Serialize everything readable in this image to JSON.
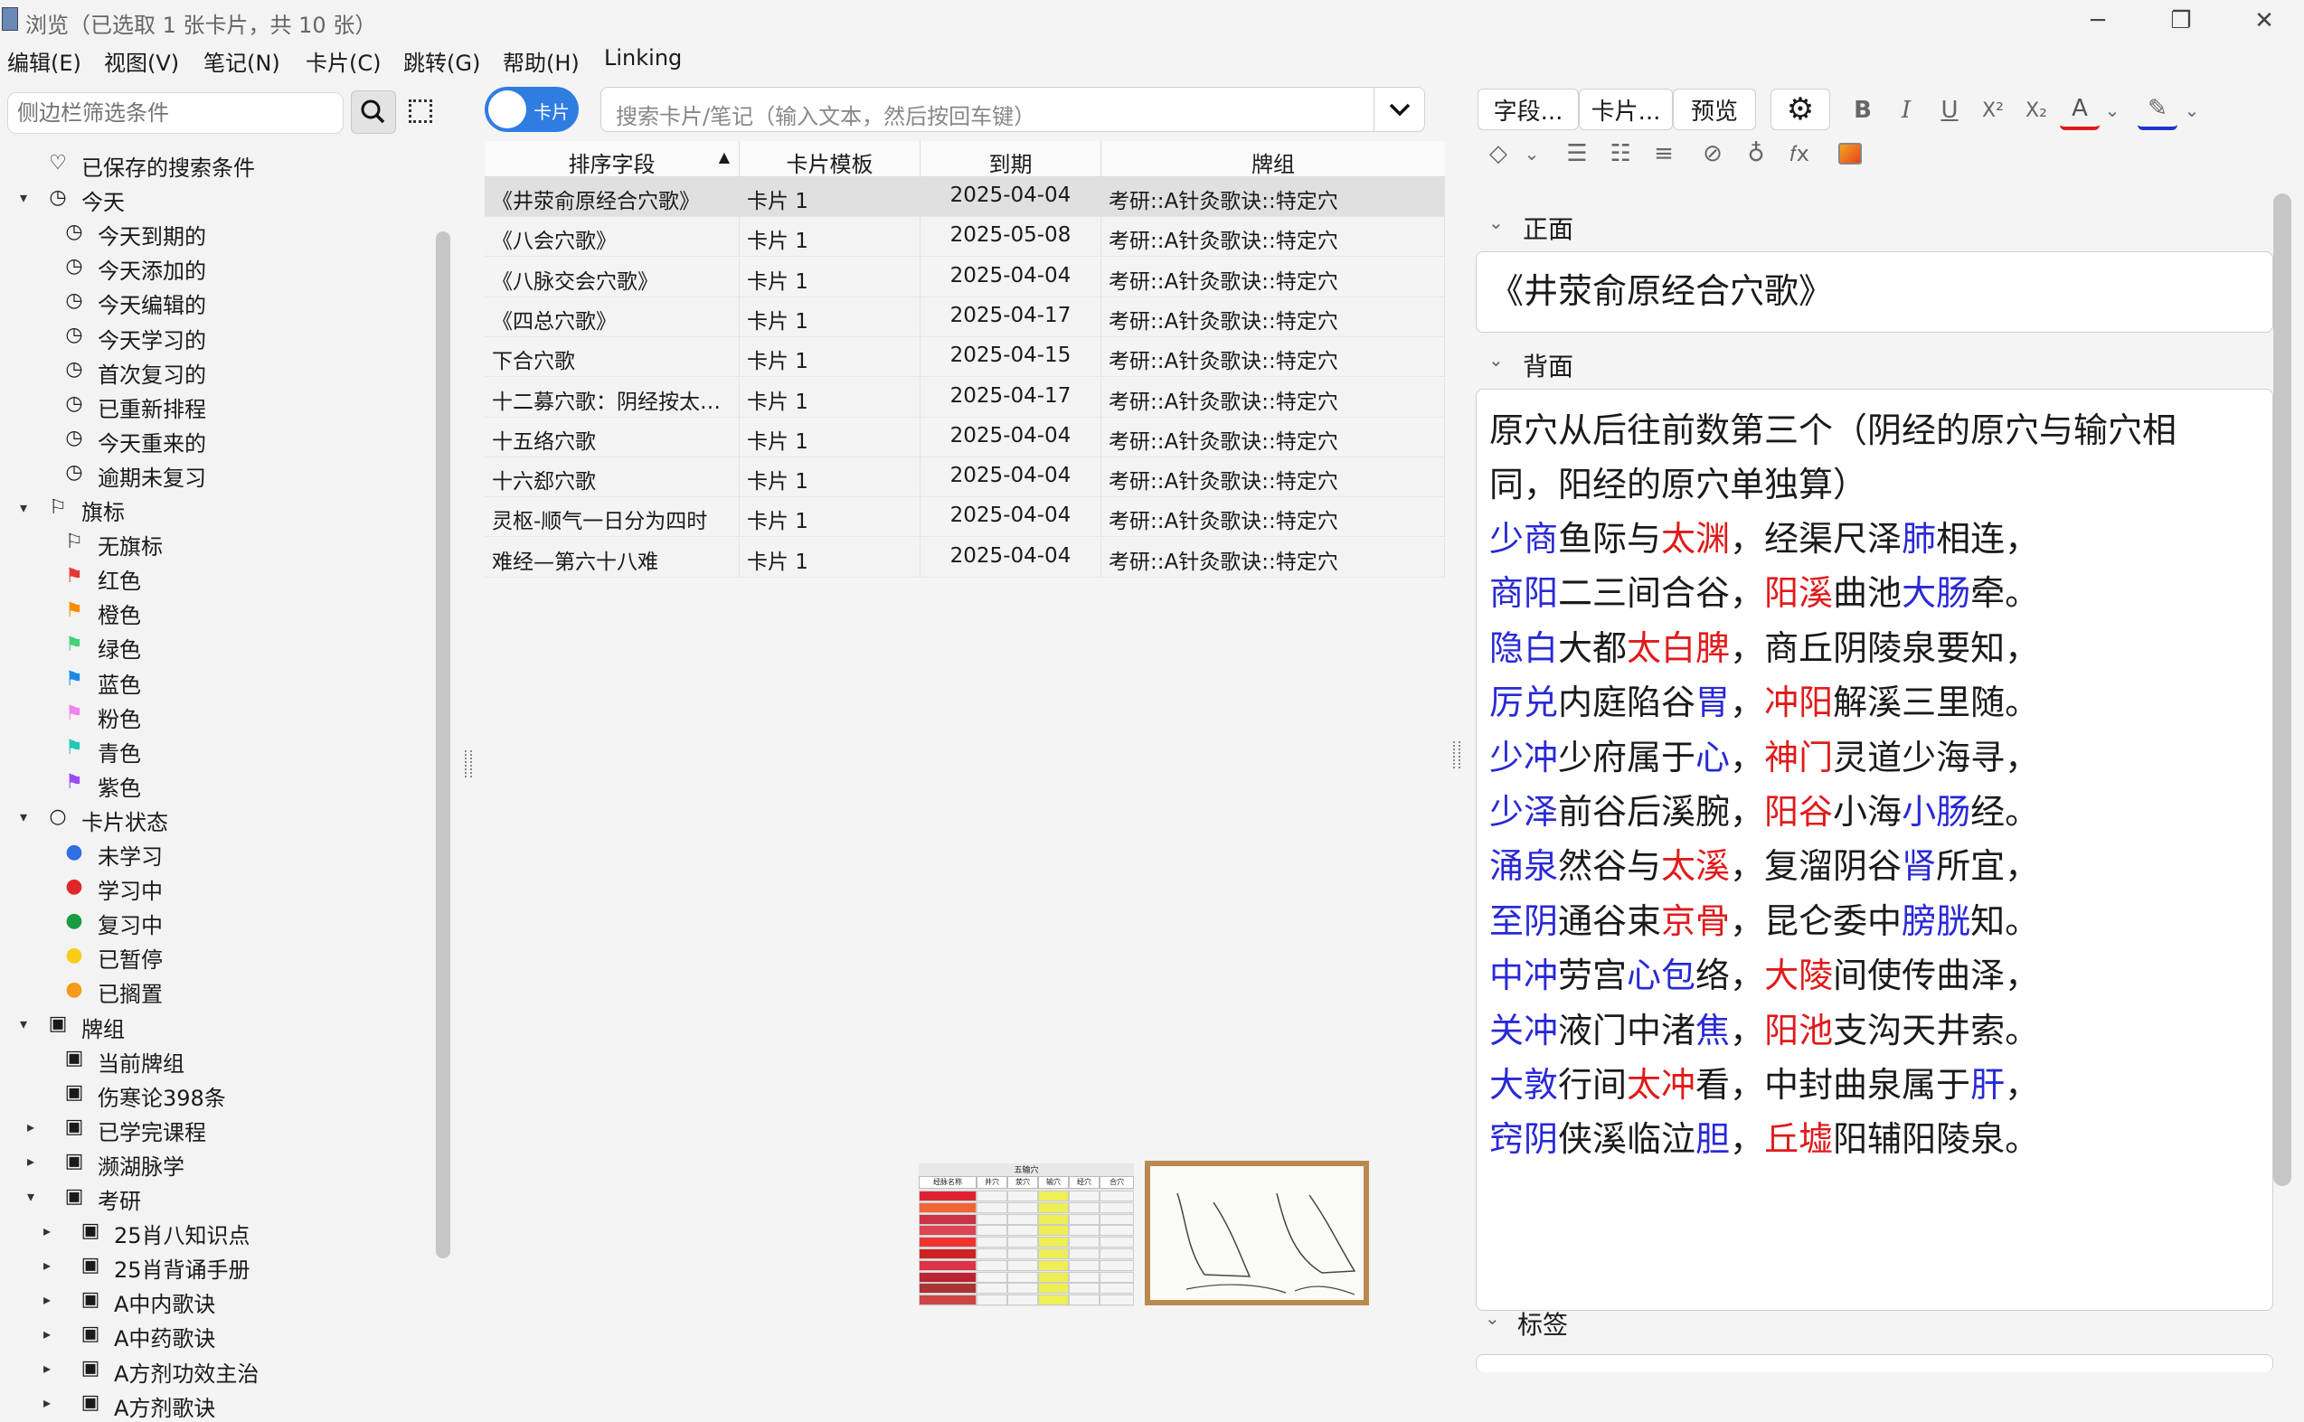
{
  "window": {
    "title": "浏览（已选取 1 张卡片，共 10 张）",
    "controls": [
      "─",
      "❐",
      "✕"
    ]
  },
  "menu": [
    "编辑(E)",
    "视图(V)",
    "笔记(N)",
    "卡片(C)",
    "跳转(G)",
    "帮助(H)",
    "Linking"
  ],
  "sidebar": {
    "filter_placeholder": "侧边栏筛选条件",
    "tree": [
      {
        "label": "已保存的搜索条件",
        "icon": "heart-icon",
        "glyph": "♡",
        "depth": 0,
        "arrow": ""
      },
      {
        "label": "今天",
        "icon": "clock-icon",
        "glyph": "◷",
        "depth": 0,
        "arrow": "▾"
      },
      {
        "label": "今天到期的",
        "icon": "clock-icon",
        "glyph": "◷",
        "depth": 1,
        "arrow": ""
      },
      {
        "label": "今天添加的",
        "icon": "clock-icon",
        "glyph": "◷",
        "depth": 1,
        "arrow": ""
      },
      {
        "label": "今天编辑的",
        "icon": "clock-icon",
        "glyph": "◷",
        "depth": 1,
        "arrow": ""
      },
      {
        "label": "今天学习的",
        "icon": "clock-icon",
        "glyph": "◷",
        "depth": 1,
        "arrow": ""
      },
      {
        "label": "首次复习的",
        "icon": "clock-icon",
        "glyph": "◷",
        "depth": 1,
        "arrow": ""
      },
      {
        "label": "已重新排程",
        "icon": "clock-icon",
        "glyph": "◷",
        "depth": 1,
        "arrow": ""
      },
      {
        "label": "今天重来的",
        "icon": "clock-icon",
        "glyph": "◷",
        "depth": 1,
        "arrow": ""
      },
      {
        "label": "逾期未复习",
        "icon": "clock-icon",
        "glyph": "◷",
        "depth": 1,
        "arrow": ""
      },
      {
        "label": "旗标",
        "icon": "flag-outline-icon",
        "glyph": "⚐",
        "depth": 0,
        "arrow": "▾"
      },
      {
        "label": "无旗标",
        "icon": "no-flag-icon",
        "glyph": "⚐",
        "depth": 1,
        "arrow": "",
        "color": "#222222"
      },
      {
        "label": "红色",
        "icon": "flag-red-icon",
        "glyph": "⚑",
        "depth": 1,
        "arrow": "",
        "color": "#e53935"
      },
      {
        "label": "橙色",
        "icon": "flag-orange-icon",
        "glyph": "⚑",
        "depth": 1,
        "arrow": "",
        "color": "#fb8c00"
      },
      {
        "label": "绿色",
        "icon": "flag-green-icon",
        "glyph": "⚑",
        "depth": 1,
        "arrow": "",
        "color": "#43d17a"
      },
      {
        "label": "蓝色",
        "icon": "flag-blue-icon",
        "glyph": "⚑",
        "depth": 1,
        "arrow": "",
        "color": "#1e88e5"
      },
      {
        "label": "粉色",
        "icon": "flag-pink-icon",
        "glyph": "⚑",
        "depth": 1,
        "arrow": "",
        "color": "#ee82ee"
      },
      {
        "label": "青色",
        "icon": "flag-cyan-icon",
        "glyph": "⚑",
        "depth": 1,
        "arrow": "",
        "color": "#26c6b5"
      },
      {
        "label": "紫色",
        "icon": "flag-purple-icon",
        "glyph": "⚑",
        "depth": 1,
        "arrow": "",
        "color": "#9a4cf0"
      },
      {
        "label": "卡片状态",
        "icon": "circle-outline-icon",
        "glyph": "○",
        "depth": 0,
        "arrow": "▾"
      },
      {
        "label": "未学习",
        "icon": "dot-blue-icon",
        "glyph": "●",
        "depth": 1,
        "arrow": "",
        "color": "#2f6fe0"
      },
      {
        "label": "学习中",
        "icon": "dot-red-icon",
        "glyph": "●",
        "depth": 1,
        "arrow": "",
        "color": "#e0262b"
      },
      {
        "label": "复习中",
        "icon": "dot-green-icon",
        "glyph": "●",
        "depth": 1,
        "arrow": "",
        "color": "#1a9b3f"
      },
      {
        "label": "已暂停",
        "icon": "dot-yellow-icon",
        "glyph": "●",
        "depth": 1,
        "arrow": "",
        "color": "#f7cd1a"
      },
      {
        "label": "已搁置",
        "icon": "dot-orange-icon",
        "glyph": "●",
        "depth": 1,
        "arrow": "",
        "color": "#f59a1a"
      },
      {
        "label": "牌组",
        "icon": "deck-icon",
        "glyph": "▣",
        "depth": 0,
        "arrow": "▾"
      },
      {
        "label": "当前牌组",
        "icon": "current-deck-icon",
        "glyph": "▣",
        "depth": 1,
        "arrow": ""
      },
      {
        "label": "伤寒论398条",
        "icon": "deck-icon",
        "glyph": "▣",
        "depth": 1,
        "arrow": ""
      },
      {
        "label": "已学完课程",
        "icon": "deck-icon",
        "glyph": "▣",
        "depth": 1,
        "arrow": "▸"
      },
      {
        "label": "濒湖脉学",
        "icon": "deck-icon",
        "glyph": "▣",
        "depth": 1,
        "arrow": "▸"
      },
      {
        "label": "考研",
        "icon": "deck-icon",
        "glyph": "▣",
        "depth": 1,
        "arrow": "▾"
      },
      {
        "label": "25肖八知识点",
        "icon": "deck-icon",
        "glyph": "▣",
        "depth": 2,
        "arrow": "▸"
      },
      {
        "label": "25肖背诵手册",
        "icon": "deck-icon",
        "glyph": "▣",
        "depth": 2,
        "arrow": "▸"
      },
      {
        "label": "A中内歌诀",
        "icon": "deck-icon",
        "glyph": "▣",
        "depth": 2,
        "arrow": "▸"
      },
      {
        "label": "A中药歌诀",
        "icon": "deck-icon",
        "glyph": "▣",
        "depth": 2,
        "arrow": "▸"
      },
      {
        "label": "A方剂功效主治",
        "icon": "deck-icon",
        "glyph": "▣",
        "depth": 2,
        "arrow": "▸"
      },
      {
        "label": "A方剂歌诀",
        "icon": "deck-icon",
        "glyph": "▣",
        "depth": 2,
        "arrow": "▸"
      }
    ]
  },
  "browser": {
    "toggle_label": "卡片",
    "search_placeholder": "搜索卡片/笔记（输入文本，然后按回车键）",
    "columns": [
      "排序字段",
      "卡片模板",
      "到期",
      "牌组"
    ],
    "sort_arrow": "▲",
    "rows": [
      [
        "《井荥俞原经合穴歌》",
        "卡片 1",
        "2025-04-04",
        "考研::A针灸歌诀::特定穴"
      ],
      [
        "《八会穴歌》",
        "卡片 1",
        "2025-05-08",
        "考研::A针灸歌诀::特定穴"
      ],
      [
        "《八脉交会穴歌》",
        "卡片 1",
        "2025-04-04",
        "考研::A针灸歌诀::特定穴"
      ],
      [
        "《四总穴歌》",
        "卡片 1",
        "2025-04-17",
        "考研::A针灸歌诀::特定穴"
      ],
      [
        "下合穴歌",
        "卡片 1",
        "2025-04-15",
        "考研::A针灸歌诀::特定穴"
      ],
      [
        "十二募穴歌：阴经按太…",
        "卡片 1",
        "2025-04-17",
        "考研::A针灸歌诀::特定穴"
      ],
      [
        "十五络穴歌",
        "卡片 1",
        "2025-04-04",
        "考研::A针灸歌诀::特定穴"
      ],
      [
        "十六郄穴歌",
        "卡片 1",
        "2025-04-04",
        "考研::A针灸歌诀::特定穴"
      ],
      [
        "灵枢-顺气一日分为四时",
        "卡片 1",
        "2025-04-04",
        "考研::A针灸歌诀::特定穴"
      ],
      [
        "难经—第六十八难",
        "卡片 1",
        "2025-04-04",
        "考研::A针灸歌诀::特定穴"
      ]
    ]
  },
  "editor": {
    "fields_button": "字段...",
    "cards_button": "卡片...",
    "preview_button": "预览",
    "format": {
      "bold": "B",
      "italic": "I",
      "underline": "U",
      "sup": "X²",
      "sub": "X₂",
      "color_a": "A",
      "dd": "⌄",
      "fx": "𝑓x"
    },
    "front_label": "正面",
    "back_label": "背面",
    "tags_label": "标签",
    "front_text": "《井荥俞原经合穴歌》",
    "back_intro_1": "原穴从后往前数第三个（阴经的原穴与输穴相",
    "back_intro_2": "同，阳经的原穴单独算）",
    "back_lines": [
      [
        [
          "少商",
          "b"
        ],
        [
          "鱼际与",
          ""
        ],
        [
          "太渊",
          "r"
        ],
        [
          "，经渠尺泽",
          ""
        ],
        [
          "肺",
          "b"
        ],
        [
          "相连，",
          ""
        ]
      ],
      [
        [
          "商阳",
          "b"
        ],
        [
          "二三间合谷，",
          ""
        ],
        [
          "阳溪",
          "r"
        ],
        [
          "曲池",
          ""
        ],
        [
          "大肠",
          "b"
        ],
        [
          "牵。",
          ""
        ]
      ],
      [
        [
          "隐白",
          "b"
        ],
        [
          "大都",
          ""
        ],
        [
          "太白",
          "r"
        ],
        [
          "脾",
          "r"
        ],
        [
          "，商丘阴陵泉要知，",
          ""
        ]
      ],
      [
        [
          "厉兑",
          "b"
        ],
        [
          "内庭陷谷",
          ""
        ],
        [
          "胃",
          "b"
        ],
        [
          "，",
          ""
        ],
        [
          "冲阳",
          "r"
        ],
        [
          "解溪三里随。",
          ""
        ]
      ],
      [
        [
          "少冲",
          "b"
        ],
        [
          "少府属于",
          ""
        ],
        [
          "心",
          "b"
        ],
        [
          "，",
          ""
        ],
        [
          "神门",
          "r"
        ],
        [
          "灵道少海寻，",
          ""
        ]
      ],
      [
        [
          "少泽",
          "b"
        ],
        [
          "前谷后溪腕，",
          ""
        ],
        [
          "阳谷",
          "r"
        ],
        [
          "小海",
          ""
        ],
        [
          "小肠",
          "b"
        ],
        [
          "经。",
          ""
        ]
      ],
      [
        [
          "涌泉",
          "b"
        ],
        [
          "然谷与",
          ""
        ],
        [
          "太溪",
          "r"
        ],
        [
          "，复溜阴谷",
          ""
        ],
        [
          "肾",
          "b"
        ],
        [
          "所宜，",
          ""
        ]
      ],
      [
        [
          "至阴",
          "b"
        ],
        [
          "通谷束",
          ""
        ],
        [
          "京骨",
          "r"
        ],
        [
          "，昆仑委中",
          ""
        ],
        [
          "膀胱",
          "b"
        ],
        [
          "知。",
          ""
        ]
      ],
      [
        [
          "中冲",
          "b"
        ],
        [
          "劳宫",
          ""
        ],
        [
          "心包",
          "b"
        ],
        [
          "络，",
          ""
        ],
        [
          "大陵",
          "r"
        ],
        [
          "间使传曲泽，",
          ""
        ]
      ],
      [
        [
          "关冲",
          "b"
        ],
        [
          "液门中渚",
          ""
        ],
        [
          "焦",
          "b"
        ],
        [
          "，",
          ""
        ],
        [
          "阳池",
          "r"
        ],
        [
          "支沟天井索。",
          ""
        ]
      ],
      [
        [
          "大敦",
          "b"
        ],
        [
          "行间",
          ""
        ],
        [
          "太冲",
          "r"
        ],
        [
          "看，中封曲泉属于",
          ""
        ],
        [
          "肝",
          "b"
        ],
        [
          "，",
          ""
        ]
      ],
      [
        [
          "窍阴",
          "b"
        ],
        [
          "侠溪临泣",
          ""
        ],
        [
          "胆",
          "b"
        ],
        [
          "，",
          ""
        ],
        [
          "丘墟",
          "r"
        ],
        [
          "阳辅阳陵泉。",
          ""
        ]
      ]
    ],
    "image_table_title": "五输穴",
    "image_table_headers": [
      "经脉名称",
      "井穴",
      "荥穴",
      "输穴",
      "经穴",
      "合穴"
    ]
  },
  "colors": {
    "accent": "#2f7de1",
    "blue_text": "#2929d6",
    "red_text": "#e01a1a"
  }
}
